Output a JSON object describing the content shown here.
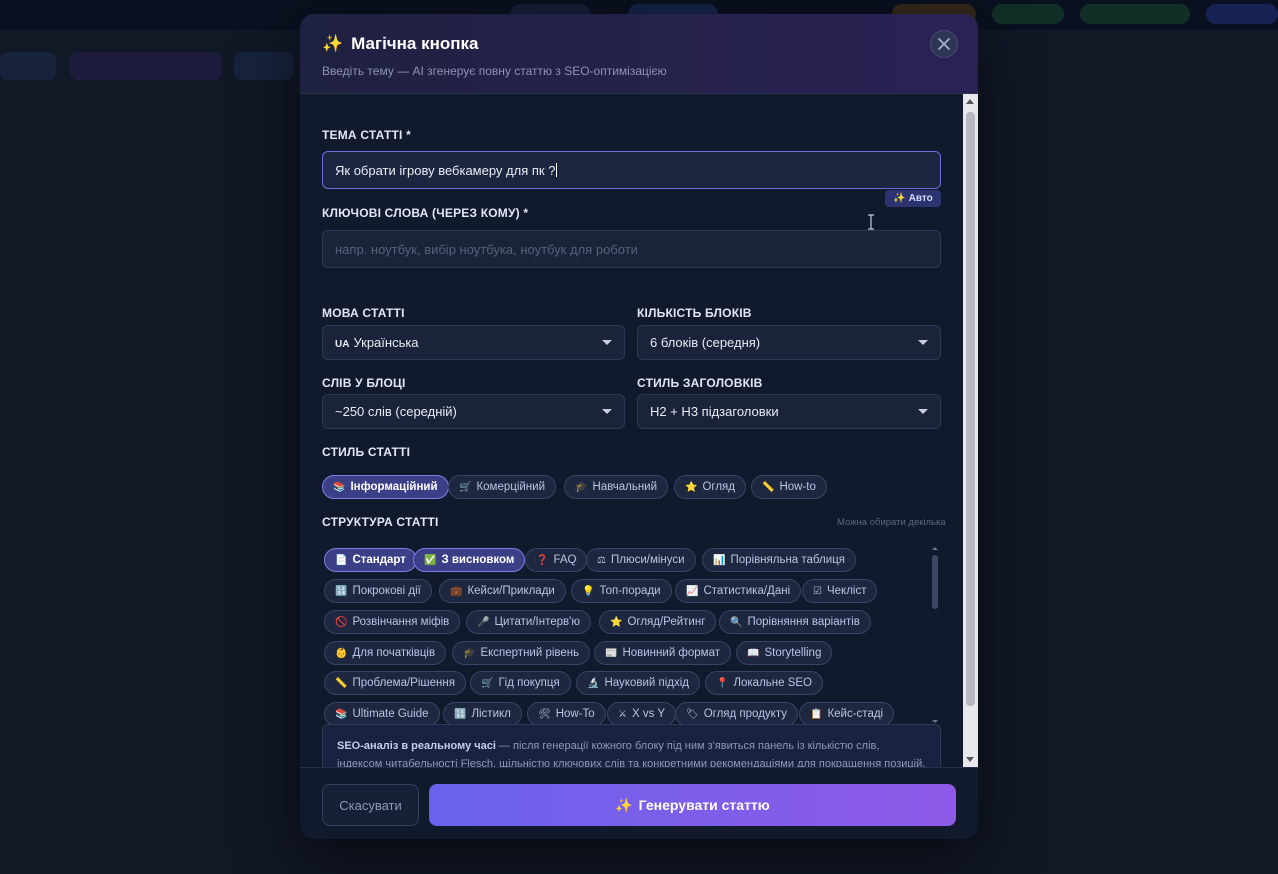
{
  "modal": {
    "title": "Магічна кнопка",
    "title_icon": "sparkles-icon",
    "subtitle": "Введіть тему — AI згенерує повну статтю з SEO-оптимізацією"
  },
  "topic": {
    "label": "ТЕМА СТАТТІ *",
    "value": "Як обрати ігрову вебкамеру для пк ?"
  },
  "keywords": {
    "label": "КЛЮЧОВІ СЛОВА (ЧЕРЕЗ КОМУ) *",
    "auto_label": "Авто",
    "placeholder": "напр. ноутбук, вибір ноутбука, ноутбук для роботи"
  },
  "language": {
    "label": "МОВА СТАТТІ",
    "flag": "UA",
    "value": "Українська"
  },
  "blocks_count": {
    "label": "КІЛЬКІСТЬ БЛОКІВ",
    "value": "6 блоків (середня)"
  },
  "words_per_block": {
    "label": "СЛІВ У БЛОЦІ",
    "value": "~250 слів (середній)"
  },
  "heading_style": {
    "label": "СТИЛЬ ЗАГОЛОВКІВ",
    "value": "H2 + H3 підзаголовки"
  },
  "article_style": {
    "label": "СТИЛЬ СТАТТІ",
    "options": [
      {
        "icon": "📚",
        "label": "Інформаційний",
        "active": true
      },
      {
        "icon": "🛒",
        "label": "Комерційний",
        "active": false
      },
      {
        "icon": "🎓",
        "label": "Навчальний",
        "active": false
      },
      {
        "icon": "⭐",
        "label": "Огляд",
        "active": false
      },
      {
        "icon": "📏",
        "label": "How-to",
        "active": false
      }
    ]
  },
  "structure": {
    "label": "СТРУКТУРА СТАТТІ",
    "hint": "Можна обирати декілька",
    "rows": [
      [
        {
          "icon": "📄",
          "label": "Стандарт",
          "active": true
        },
        {
          "icon": "✅",
          "label": "З висновком",
          "active": true
        },
        {
          "icon": "❓",
          "label": "FAQ",
          "active": false
        },
        {
          "icon": "⚖",
          "label": "Плюси/мінуси",
          "active": false
        },
        {
          "icon": "📊",
          "label": "Порівняльна таблиця",
          "active": false
        }
      ],
      [
        {
          "icon": "🔢",
          "label": "Покрокові дії",
          "active": false
        },
        {
          "icon": "💼",
          "label": "Кейси/Приклади",
          "active": false
        },
        {
          "icon": "💡",
          "label": "Топ-поради",
          "active": false
        },
        {
          "icon": "📈",
          "label": "Статистика/Дані",
          "active": false
        },
        {
          "icon": "☑",
          "label": "Чекліст",
          "active": false
        }
      ],
      [
        {
          "icon": "🚫",
          "label": "Розвінчання міфів",
          "active": false
        },
        {
          "icon": "🎤",
          "label": "Цитати/Інтерв'ю",
          "active": false
        },
        {
          "icon": "⭐",
          "label": "Огляд/Рейтинг",
          "active": false
        },
        {
          "icon": "🔍",
          "label": "Порівняння варіантів",
          "active": false
        }
      ],
      [
        {
          "icon": "👶",
          "label": "Для початківців",
          "active": false
        },
        {
          "icon": "🎓",
          "label": "Експертний рівень",
          "active": false
        },
        {
          "icon": "📰",
          "label": "Новинний формат",
          "active": false
        },
        {
          "icon": "📖",
          "label": "Storytelling",
          "active": false
        }
      ],
      [
        {
          "icon": "📏",
          "label": "Проблема/Рішення",
          "active": false
        },
        {
          "icon": "🛒",
          "label": "Гід покупця",
          "active": false
        },
        {
          "icon": "🔬",
          "label": "Науковий підхід",
          "active": false
        },
        {
          "icon": "📍",
          "label": "Локальне SEO",
          "active": false
        }
      ],
      [
        {
          "icon": "📚",
          "label": "Ultimate Guide",
          "active": false
        },
        {
          "icon": "🔢",
          "label": "Лістикл",
          "active": false
        },
        {
          "icon": "🛠",
          "label": "How-To",
          "active": false
        },
        {
          "icon": "⚔",
          "label": "X vs Y",
          "active": false
        },
        {
          "icon": "🏷",
          "label": "Огляд продукту",
          "active": false
        },
        {
          "icon": "📋",
          "label": "Кейс-стаді",
          "active": false
        }
      ]
    ]
  },
  "info": {
    "bold": "SEO-аналіз в реальному часі",
    "text": " — після генерації кожного блоку під ним з'явиться панель із кількістю слів, індексом читабельності Flesch, щільністю ключових слів та конкретними рекомендаціями для покращення позицій."
  },
  "footer": {
    "cancel_label": "Скасувати",
    "generate_label": "Генерувати статтю",
    "generate_icon": "sparkles-icon"
  },
  "colors": {
    "accent": "#6a62ec",
    "accent2": "#8f5ae8",
    "modal_bg": "#111a2c",
    "chip_active": "#3a3f86"
  }
}
